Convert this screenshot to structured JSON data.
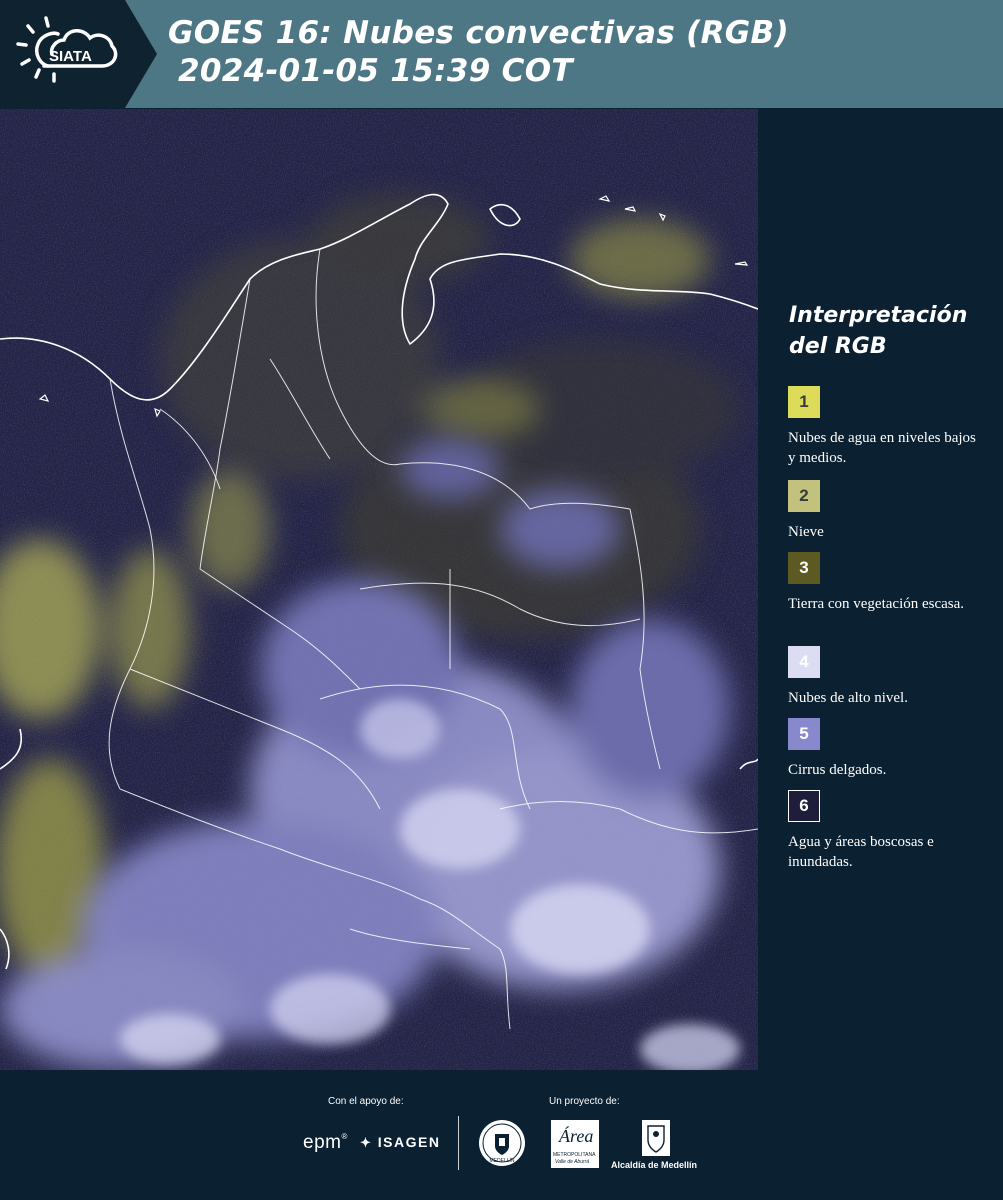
{
  "header": {
    "logo_text": "SIATA",
    "title_line1": "GOES 16: Nubes convectivas (RGB)",
    "title_line2": "2024-01-05 15:39 COT"
  },
  "map": {
    "subject": "satellite-rgb-composite-colombia",
    "colors": {
      "background": "#222248",
      "borders": "#ffffff"
    }
  },
  "legend": {
    "title_line1": "Interpretación",
    "title_line2": "del RGB",
    "items": [
      {
        "number": "1",
        "label": "Nubes de agua en niveles bajos y medios.",
        "color": "#dcdc5a"
      },
      {
        "number": "2",
        "label": "Nieve",
        "color": "#c2c27c"
      },
      {
        "number": "3",
        "label": "Tierra con vegetación escasa.",
        "color": "#5c5a22"
      },
      {
        "number": "4",
        "label": "Nubes de alto nivel.",
        "color": "#dcdcf2"
      },
      {
        "number": "5",
        "label": "Cirrus delgados.",
        "color": "#8888cc"
      },
      {
        "number": "6",
        "label": "Agua y áreas boscosas e inundadas.",
        "color": "#1e1e3a"
      }
    ]
  },
  "footer": {
    "support_label": "Con el apoyo de:",
    "project_label": "Un proyecto de:",
    "sponsor1": "epm",
    "sponsor2": "ISAGEN",
    "org1_caption": "MEDELLÍN",
    "org2_name": "Área",
    "org2_caption": "METROPOLITANA",
    "org2_sub": "Valle de Aburrá",
    "org3_caption": "Alcaldía de Medellín"
  }
}
